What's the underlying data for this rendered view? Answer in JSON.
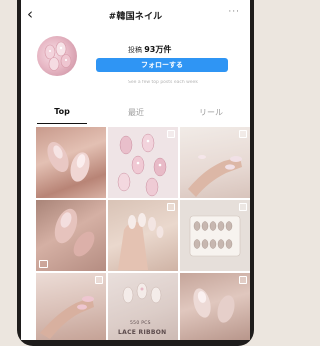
{
  "header": {
    "back_glyph": "‹",
    "title": "#韓国ネイル",
    "more_glyph": "···"
  },
  "hashtag": {
    "posts_label": "投稿",
    "posts_count": "93万件",
    "follow_label": "フォローする",
    "subtitle": "See a few top posts each week"
  },
  "tabs": [
    {
      "label": "Top",
      "active": true
    },
    {
      "label": "最近",
      "active": false
    },
    {
      "label": "リール",
      "active": false
    }
  ],
  "grid": {
    "overlay_text": "550 PCS",
    "overlay_text_2": "LACE RIBBON"
  },
  "colors": {
    "follow_button": "#2f95f4",
    "background": "#ffffff"
  }
}
